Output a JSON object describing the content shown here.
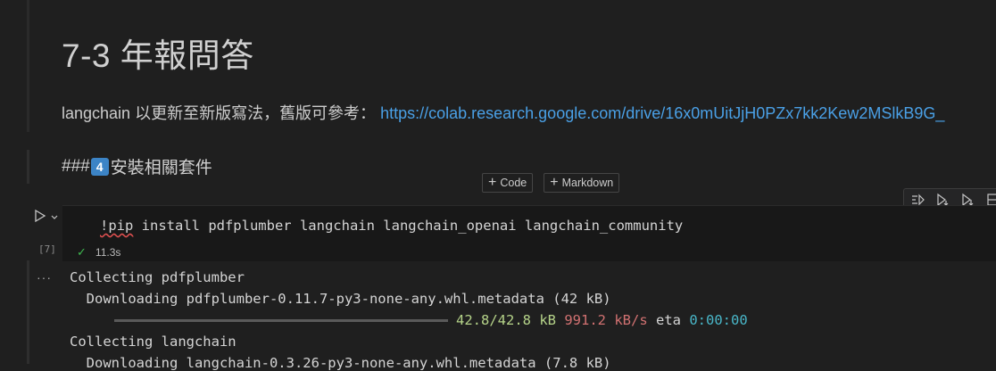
{
  "markdown": {
    "title": "7-3 年報問答",
    "para_text": "langchain 以更新至新版寫法，舊版可參考： ",
    "para_link": "https://colab.research.google.com/drive/16x0mUitJjH0PZx7kk2Kew2MSlkB9G_",
    "heading_prefix": "###",
    "heading_keycap": "4",
    "heading_text": "安裝相關套件"
  },
  "add_cell": {
    "code_label": "Code",
    "markdown_label": "Markdown"
  },
  "cell": {
    "execution_count": "[7]",
    "code_squiggle": "!pip",
    "code_rest": " install pdfplumber langchain langchain_openai langchain_community",
    "duration": "11.3s"
  },
  "output": {
    "line1": "Collecting pdfplumber",
    "line2": "  Downloading pdfplumber-0.11.7-py3-none-any.whl.metadata (42 kB)",
    "progress_fraction": 1.0,
    "progress_size": "42.8/42.8 kB",
    "progress_speed": "991.2 kB/s",
    "progress_eta_label": "eta",
    "progress_eta": "0:00:00",
    "line4": "Collecting langchain",
    "line5": "  Downloading langchain-0.3.26-py3-none-any.whl.metadata (7.8 kB)"
  },
  "icons": {
    "run": "play-icon",
    "run_menu": "chevron-down-icon",
    "status": "check-icon",
    "more": "ellipsis-icon"
  }
}
